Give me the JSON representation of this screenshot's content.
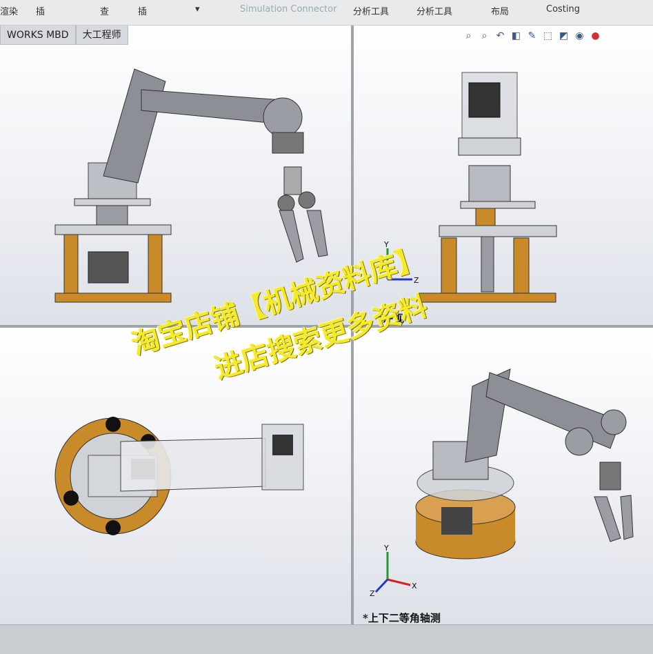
{
  "menubar": {
    "items": [
      "渲染",
      "插",
      "查",
      "插",
      "",
      "Simulation Connector",
      "分析工具",
      "分析工具",
      "布局",
      "Costing"
    ]
  },
  "tabs": {
    "items": [
      "WORKS MBD",
      "大工程师"
    ]
  },
  "viewports": {
    "top_right_label": "*左视",
    "bottom_right_label": "*上下二等角轴测"
  },
  "hud": {
    "icons": [
      "zoom-to-fit-icon",
      "zoom-area-icon",
      "previous-view-icon",
      "section-view-icon",
      "dynamic-annotation-icon",
      "view-orientation-icon",
      "display-style-icon",
      "hide-show-icon",
      "appearance-icon"
    ]
  },
  "axes": {
    "x": "X",
    "y": "Y",
    "z": "Z"
  },
  "watermark": {
    "line1": "淘宝店铺【机械资料库】",
    "line2": "进店搜索更多资料"
  },
  "colors": {
    "wood": "#c98a2a",
    "metal": "#8c8f95",
    "accent_axis_y": "#1f9b2f",
    "accent_axis_x": "#d82020",
    "accent_axis_z": "#2038c8"
  }
}
